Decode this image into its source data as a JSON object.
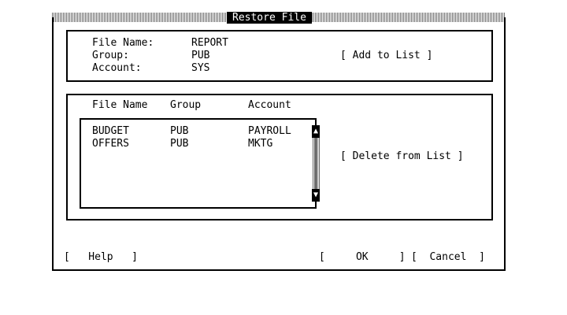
{
  "dialog": {
    "title": "Restore File"
  },
  "file_info": {
    "file_name_label": "File Name:",
    "file_name_value": "REPORT",
    "group_label": "Group:",
    "group_value": "PUB",
    "account_label": "Account:",
    "account_value": "SYS",
    "add_button": "[ Add to List ]"
  },
  "list": {
    "columns": [
      "File Name",
      "Group",
      "Account"
    ],
    "rows": [
      [
        "BUDGET",
        "PUB",
        "PAYROLL"
      ],
      [
        "OFFERS",
        "PUB",
        "MKTG"
      ]
    ],
    "scroll_up_icon": "triangle-up",
    "scroll_down_icon": "triangle-down",
    "delete_button": "[ Delete from List ]"
  },
  "buttons": {
    "help": "[   Help   ]",
    "ok": "[     OK     ]",
    "cancel": "[  Cancel  ]"
  }
}
